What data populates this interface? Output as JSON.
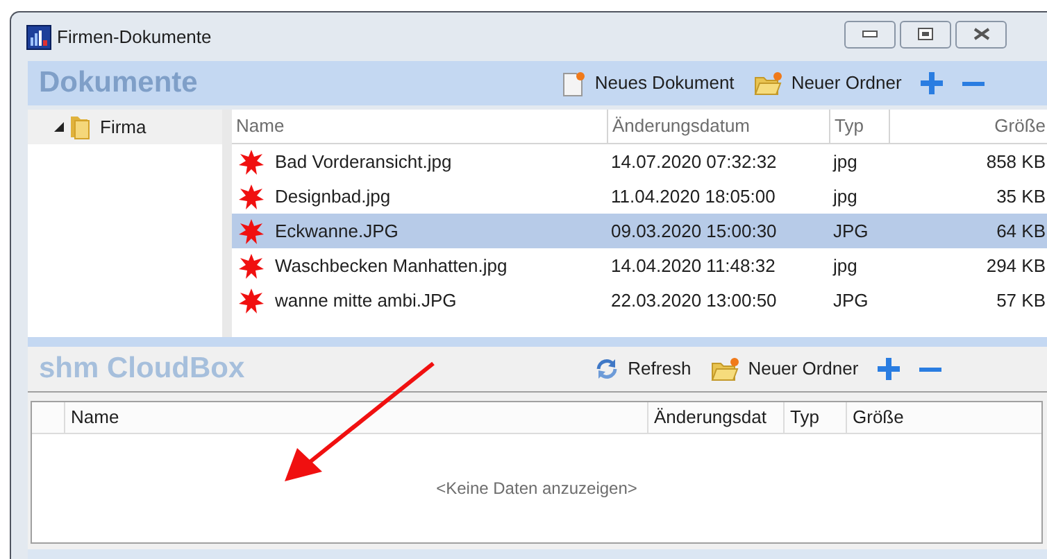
{
  "window": {
    "title": "Firmen-Dokumente"
  },
  "documents": {
    "title": "Dokumente",
    "toolbar": [
      {
        "kind": "document",
        "label": "Neues Dokument"
      },
      {
        "kind": "folder",
        "label": "Neuer Ordner"
      },
      {
        "kind": "plus"
      },
      {
        "kind": "minus"
      }
    ],
    "tree": [
      {
        "label": "Firma",
        "expanded": true
      }
    ],
    "table": {
      "columns": [
        "Name",
        "Änderungsdatum",
        "Typ",
        "Größe"
      ],
      "rows": [
        {
          "name": "Bad Vorderansicht.jpg",
          "modified": "14.07.2020 07:32:32",
          "type": "jpg",
          "size": "858 KB",
          "selected": false
        },
        {
          "name": "Designbad.jpg",
          "modified": "11.04.2020 18:05:00",
          "type": "jpg",
          "size": "35 KB",
          "selected": false
        },
        {
          "name": "Eckwanne.JPG",
          "modified": "09.03.2020 15:00:30",
          "type": "JPG",
          "size": "64 KB",
          "selected": true
        },
        {
          "name": "Waschbecken Manhatten.jpg",
          "modified": "14.04.2020 11:48:32",
          "type": "jpg",
          "size": "294 KB",
          "selected": false
        },
        {
          "name": "wanne mitte ambi.JPG",
          "modified": "22.03.2020 13:00:50",
          "type": "JPG",
          "size": "57 KB",
          "selected": false
        }
      ]
    }
  },
  "cloudbox": {
    "title": "shm CloudBox",
    "toolbar": [
      {
        "kind": "refresh",
        "label": "Refresh"
      },
      {
        "kind": "folder",
        "label": "Neuer Ordner"
      },
      {
        "kind": "plus"
      },
      {
        "kind": "minus"
      }
    ],
    "table": {
      "columns": [
        "Name",
        "Änderungsdat",
        "Typ",
        "Größe"
      ],
      "empty_text": "<Keine Daten anzuzeigen>"
    }
  }
}
